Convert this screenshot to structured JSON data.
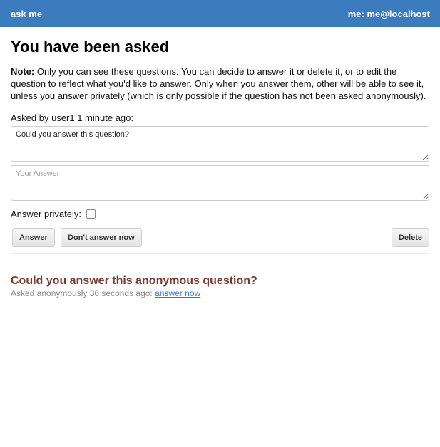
{
  "header": {
    "brand": "ask me",
    "user_label": "me: me@localhost"
  },
  "page": {
    "title": "You have been asked",
    "note_label": "Note:",
    "note_text": "Only you can see these questions. You can decide to answer it or delete it, or to edit the question to reflect what you'd like to answer. Only when you answer them, other will be able to see it, unless you answer privately (which is only possible if the question has not been asked anonymously)."
  },
  "question": {
    "asked_label": "Asked by user1 1 minute ago:",
    "text": "Could you answer this question?",
    "answer_placeholder": "Your Answer",
    "answer_value": "",
    "private_label": "Answer privately:",
    "private_checked": false,
    "answer_button": "Answer",
    "dont_answer_button": "Don't answer now",
    "delete_button": "Delete"
  },
  "anonymous_question": {
    "text": "Could you answer this anonymous question?",
    "meta": "Asked anonymously 36 seconds ago:",
    "link": "answer now"
  },
  "colors": {
    "header_bg": "#3d7bbf",
    "anon_title": "#7a3a2e",
    "link": "#2f7bd1"
  }
}
